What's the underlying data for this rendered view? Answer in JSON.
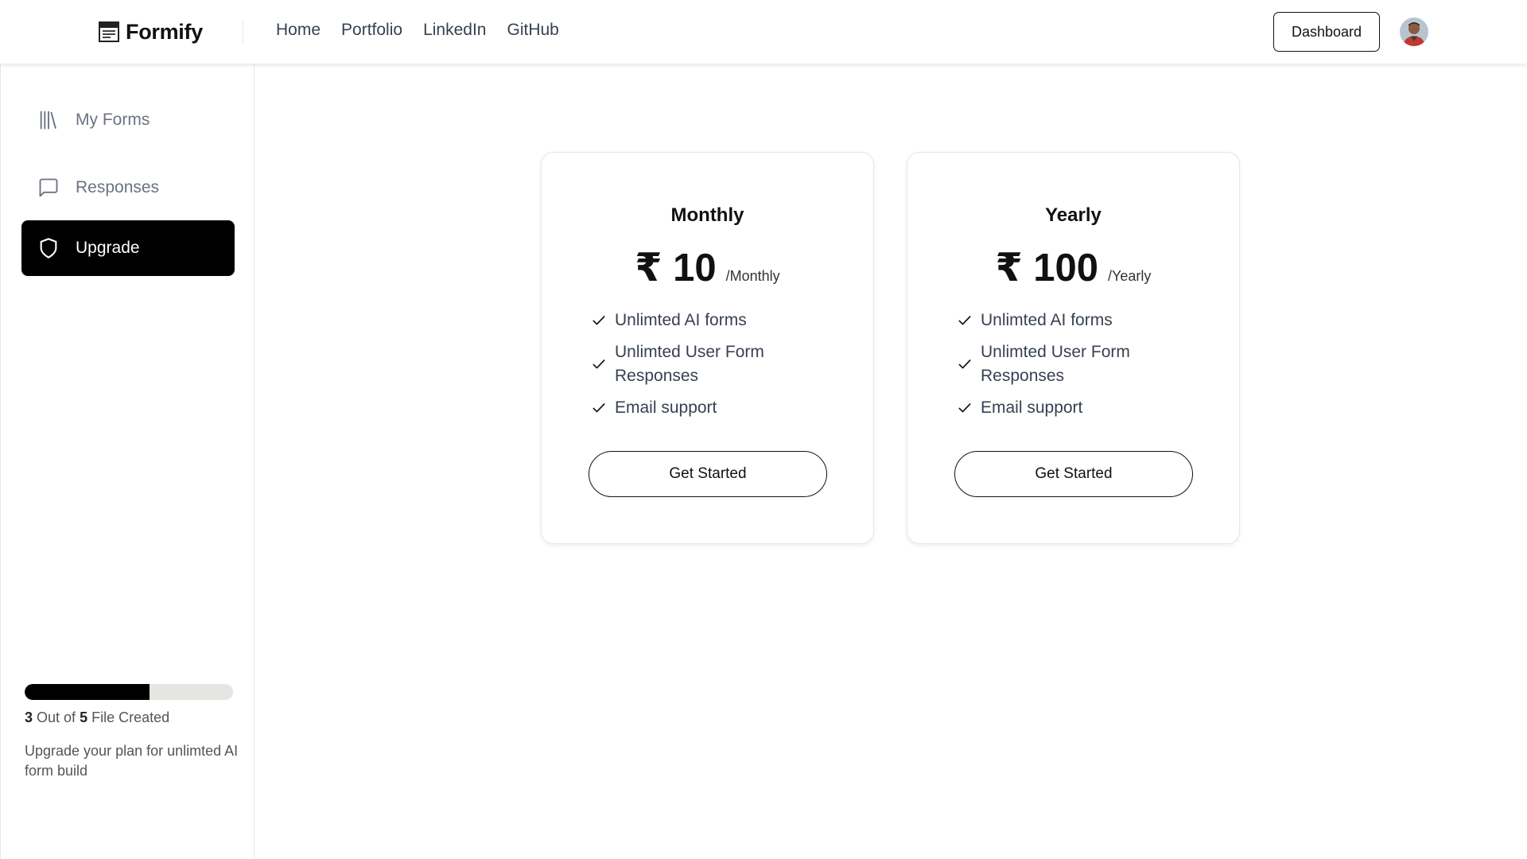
{
  "header": {
    "brand": "Formify",
    "nav": [
      "Home",
      "Portfolio",
      "LinkedIn",
      "GitHub"
    ],
    "dashboard_label": "Dashboard"
  },
  "sidebar": {
    "items": [
      {
        "label": "My Forms",
        "icon": "library-icon",
        "active": false
      },
      {
        "label": "Responses",
        "icon": "message-square-icon",
        "active": false
      },
      {
        "label": "Upgrade",
        "icon": "shield-icon",
        "active": true
      }
    ],
    "usage": {
      "created": "3",
      "text_mid": "Out of",
      "total": "5",
      "text_end": "File Created",
      "progress_fraction": 0.6
    },
    "upgrade_note": "Upgrade your plan for unlimted AI form build"
  },
  "plans": [
    {
      "name": "Monthly",
      "price": "₹ 10",
      "period": "/Monthly",
      "features": [
        "Unlimted AI forms",
        "Unlimted User Form Responses",
        "Email support"
      ],
      "cta": "Get Started"
    },
    {
      "name": "Yearly",
      "price": "₹ 100",
      "period": "/Yearly",
      "features": [
        "Unlimted AI forms",
        "Unlimted User Form Responses",
        "Email support"
      ],
      "cta": "Get Started"
    }
  ],
  "colors": {
    "accent": "#000000",
    "text_muted": "#6b7280",
    "track": "#e5e5e2"
  }
}
